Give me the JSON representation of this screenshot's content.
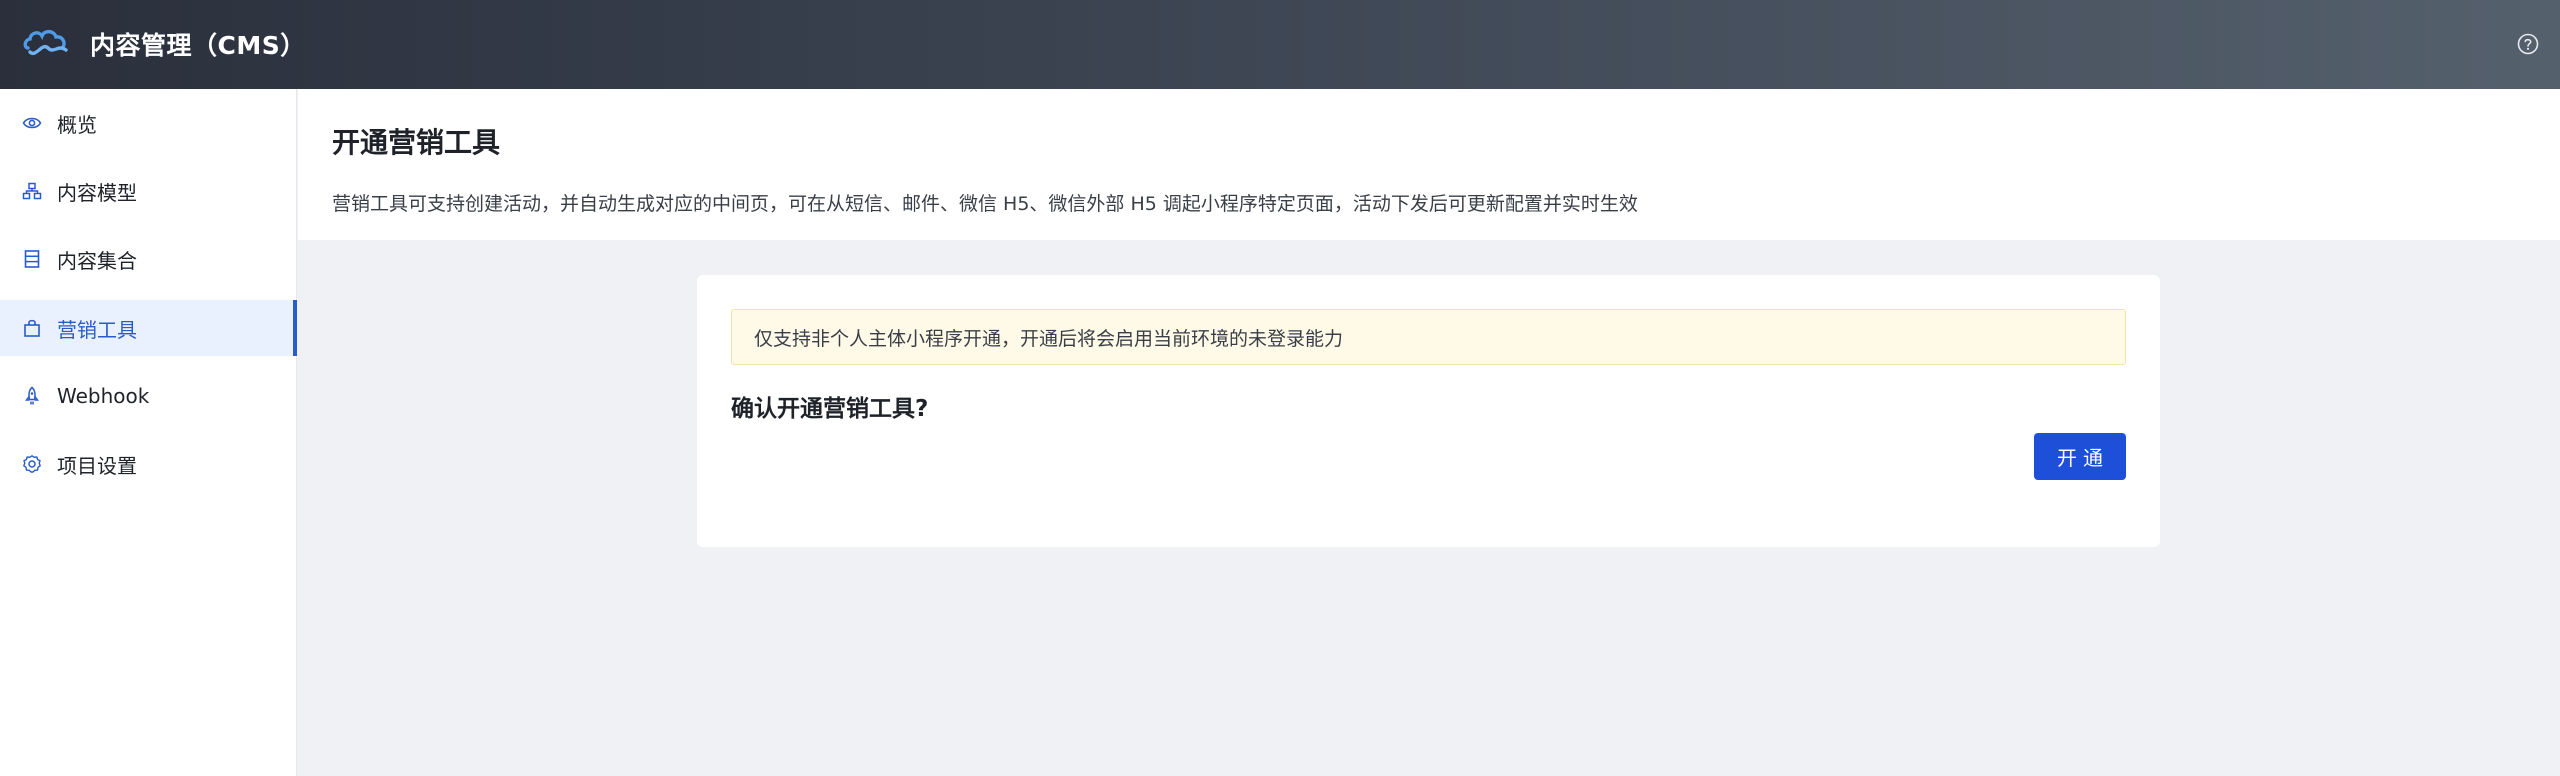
{
  "header": {
    "app_title": "内容管理（CMS）",
    "logo_icon": "cloud-logo-icon",
    "help_icon": "help-circle-icon"
  },
  "sidebar": {
    "items": [
      {
        "label": "概览",
        "icon": "eye-icon"
      },
      {
        "label": "内容模型",
        "icon": "model-hierarchy-icon"
      },
      {
        "label": "内容集合",
        "icon": "collection-list-icon"
      },
      {
        "label": "营销工具",
        "icon": "shopping-bag-icon",
        "active": true
      },
      {
        "label": "Webhook",
        "icon": "rocket-icon"
      },
      {
        "label": "项目设置",
        "icon": "gear-icon"
      }
    ]
  },
  "main": {
    "title": "开通营销工具",
    "description": "营销工具可支持创建活动，并自动生成对应的中间页，可在从短信、邮件、微信 H5、微信外部 H5 调起小程序特定页面，活动下发后可更新配置并实时生效",
    "card": {
      "notice": "仅支持非个人主体小程序开通，开通后将会启用当前环境的未登录能力",
      "confirm_title": "确认开通营销工具?",
      "open_button": "开通"
    }
  },
  "colors": {
    "accent": "#1d4fd8",
    "active_nav": "#2a5cc7",
    "notice_bg": "#fffae8"
  }
}
